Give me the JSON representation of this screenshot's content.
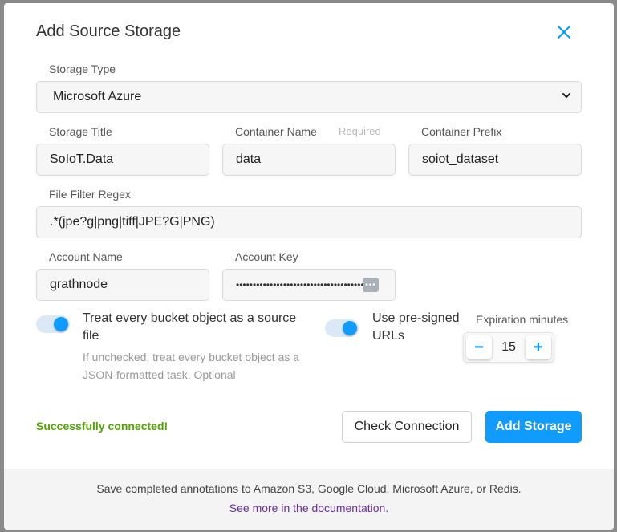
{
  "modal": {
    "title": "Add Source Storage",
    "close_icon": "close-icon"
  },
  "storage_type": {
    "label": "Storage Type",
    "value": "Microsoft Azure"
  },
  "storage_title": {
    "label": "Storage Title",
    "value": "SoIoT.Data"
  },
  "container_name": {
    "label": "Container Name",
    "required": "Required",
    "value": "data"
  },
  "container_prefix": {
    "label": "Container Prefix",
    "value": "soiot_dataset"
  },
  "file_filter": {
    "label": "File Filter Regex",
    "value": ".*(jpe?g|png|tiff|JPE?G|PNG)"
  },
  "account_name": {
    "label": "Account Name",
    "value": "grathnode"
  },
  "account_key": {
    "label": "Account Key",
    "value": "••••••••••••••••••••••••••••••••••••••••"
  },
  "treat_objects": {
    "label": "Treat every bucket object as a source file",
    "hint": "If unchecked, treat every bucket object as a JSON-formatted task. Optional",
    "checked": true
  },
  "presigned": {
    "label": "Use pre-signed URLs",
    "checked": true
  },
  "expiration": {
    "label": "Expiration minutes",
    "value": "15",
    "minus": "−",
    "plus": "+"
  },
  "status": {
    "text": "Successfully connected!",
    "color": "#52a500"
  },
  "actions": {
    "check": "Check Connection",
    "add": "Add Storage"
  },
  "footer": {
    "text": "Save completed annotations to Amazon S3, Google Cloud, Microsoft Azure, or Redis.",
    "link": "See more in the documentation."
  },
  "colors": {
    "accent": "#109cff",
    "link": "#6a2d9c"
  }
}
